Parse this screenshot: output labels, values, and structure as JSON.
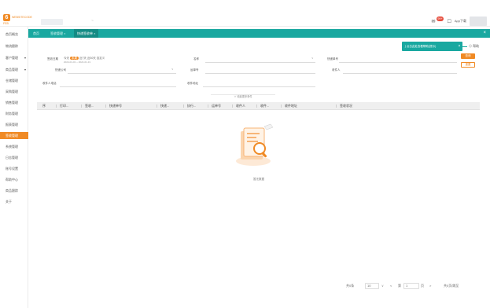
{
  "header": {
    "logo_mark": "6",
    "brand": "WEBSITECODE",
    "logo_sub": "FEB",
    "tab_mark": "~",
    "mail_icon": "✉",
    "mail_badge": "99+",
    "app_icon": "☐",
    "app_label": "App下载",
    "colors": {
      "accent": "#f08a24",
      "teal": "#19a8a0"
    }
  },
  "sidebar": {
    "items": [
      {
        "label": "首页概览"
      },
      {
        "label": "物流跟踪"
      },
      {
        "label": "客户管理",
        "caret": "▾"
      },
      {
        "label": "商品管理",
        "caret": "▾"
      },
      {
        "label": "仓储管理"
      },
      {
        "label": "采购管理"
      },
      {
        "label": "销售管理"
      },
      {
        "label": "财务管理"
      },
      {
        "label": "报表管理"
      },
      {
        "label": "签收管理",
        "active": true
      },
      {
        "label": "系统管理"
      },
      {
        "label": "日志管理"
      },
      {
        "label": "账号设置"
      },
      {
        "label": "帮助中心"
      },
      {
        "label": "商品跟踪"
      },
      {
        "label": "关于"
      }
    ]
  },
  "tabs": [
    {
      "label": "首页"
    },
    {
      "label": "签收管理 ×"
    },
    {
      "label": "快递签收单 ×",
      "active": true
    }
  ],
  "tab_close_all": "×",
  "notice": {
    "text": "∫ 点击此处查看帮助(提示)",
    "close": "×"
  },
  "help": {
    "icon": "⊙",
    "label": "帮助"
  },
  "filters": {
    "date_label": "签收日期",
    "chips": [
      "今天",
      "本周",
      "近7天",
      "近30天",
      "自定义"
    ],
    "date_range": "2024-01-01 ~ 2024-01-31",
    "f1_label": "名称",
    "f2_label": "快递单号",
    "f3_label": "快递公司",
    "f4_label": "运单号",
    "f5_label": "收件人",
    "f6_label": "收件人电话",
    "f7_label": "收件地址",
    "search_button": "查询",
    "reset_button": "重置",
    "expand": "∨ 收起更多条件",
    "select_caret": "∨"
  },
  "table": {
    "columns": [
      "序",
      "打印...",
      "签收...",
      "快递单号",
      "快递...",
      "执行...",
      "运单号",
      "收件人",
      "收件...",
      "收件地址",
      "签收状况"
    ]
  },
  "empty": {
    "text": "暂无数据"
  },
  "pager": {
    "total_label": "共0条",
    "page_size": "10",
    "page_size_caret": "∨",
    "prev": "<",
    "page_prefix": "第",
    "page_current": "1",
    "page_suffix": "页",
    "next": ">",
    "total_pages": "共0页/跳至"
  }
}
